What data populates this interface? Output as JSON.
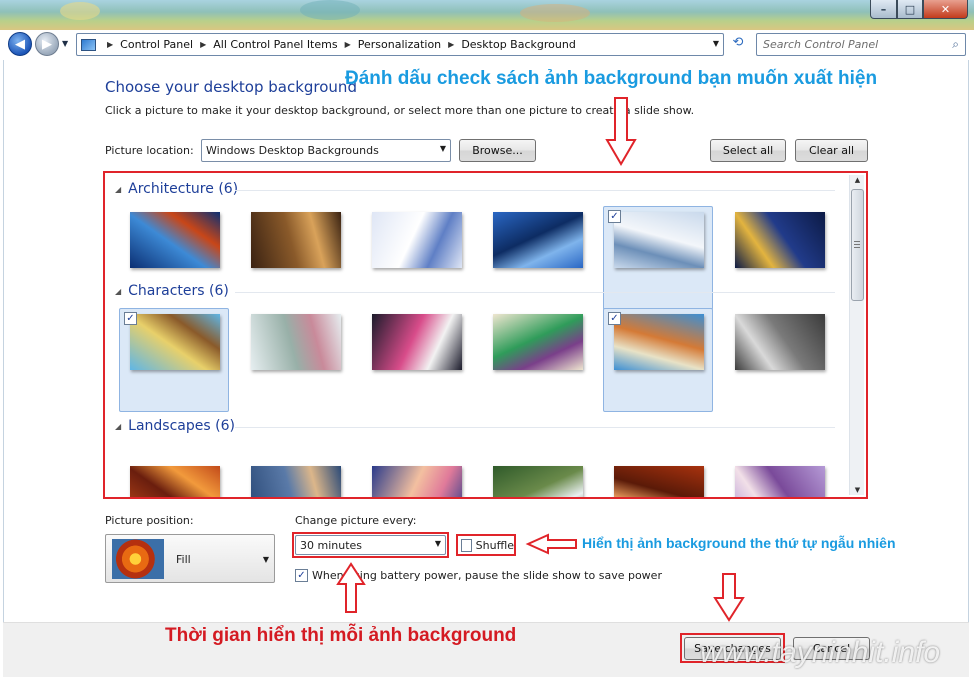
{
  "address": {
    "crumbs": [
      "Control Panel",
      "All Control Panel Items",
      "Personalization",
      "Desktop Background"
    ],
    "search_placeholder": "Search Control Panel"
  },
  "window_buttons": {
    "minimize": "–",
    "maximize": "□",
    "close": "✕"
  },
  "heading": "Choose your desktop background",
  "subtext": "Click a picture to make it your desktop background, or select more than one picture to create a slide show.",
  "picture_location": {
    "label": "Picture location:",
    "value": "Windows Desktop Backgrounds",
    "browse": "Browse...",
    "select_all": "Select all",
    "clear_all": "Clear all"
  },
  "groups": [
    {
      "title": "Architecture (6)",
      "items": [
        {
          "selected": false,
          "colors": [
            "#0b2f73",
            "#c84618",
            "#3d8ad6"
          ]
        },
        {
          "selected": false,
          "colors": [
            "#3a2212",
            "#d9a25a",
            "#8a5a2a"
          ]
        },
        {
          "selected": false,
          "colors": [
            "#dfe6f5",
            "#5f7fc5",
            "#ffffff"
          ]
        },
        {
          "selected": false,
          "colors": [
            "#2a67c4",
            "#7fb4ec",
            "#0d2c63"
          ]
        },
        {
          "selected": true,
          "colors": [
            "#c9d9ec",
            "#6c8fb8",
            "#f3f6fa"
          ]
        },
        {
          "selected": false,
          "colors": [
            "#0c1a45",
            "#e3b43f",
            "#213b8a"
          ]
        }
      ]
    },
    {
      "title": "Characters (6)",
      "items": [
        {
          "selected": true,
          "colors": [
            "#5fb6e6",
            "#8a5a2a",
            "#e8d06a"
          ]
        },
        {
          "selected": false,
          "colors": [
            "#e6eef0",
            "#c98a9a",
            "#98b0a8"
          ]
        },
        {
          "selected": false,
          "colors": [
            "#1b1b2b",
            "#f2f2f2",
            "#d84c8a"
          ]
        },
        {
          "selected": false,
          "colors": [
            "#efe6d0",
            "#7a3f8a",
            "#2f9c5a"
          ]
        },
        {
          "selected": true,
          "colors": [
            "#3d8fd3",
            "#e8e2c6",
            "#d47a36"
          ]
        },
        {
          "selected": false,
          "colors": [
            "#3b3b3b",
            "#d9d9d9",
            "#7a7a7a"
          ]
        }
      ]
    },
    {
      "title": "Landscapes (6)",
      "items": [
        {
          "selected": false,
          "colors": [
            "#c24a1a",
            "#f29a3c",
            "#6a1e0e"
          ]
        },
        {
          "selected": false,
          "colors": [
            "#2b4a78",
            "#dcb68a",
            "#5a7aa8"
          ]
        },
        {
          "selected": false,
          "colors": [
            "#2a3a8a",
            "#e07a9a",
            "#f3c0a0"
          ]
        },
        {
          "selected": false,
          "colors": [
            "#2f5a2a",
            "#e9f0f0",
            "#6a8a4a"
          ]
        },
        {
          "selected": false,
          "colors": [
            "#a8320e",
            "#f0a060",
            "#5a1a08"
          ]
        },
        {
          "selected": false,
          "colors": [
            "#b59ad6",
            "#f2e0e8",
            "#7a4a9a"
          ]
        }
      ]
    }
  ],
  "picture_position": {
    "label": "Picture position:",
    "value": "Fill"
  },
  "change_picture": {
    "label": "Change picture every:",
    "value": "30 minutes"
  },
  "shuffle": {
    "label": "Shuffle",
    "checked": false
  },
  "battery": {
    "label": "When using battery power, pause the slide show to save power",
    "checked": true
  },
  "buttons": {
    "save": "Save changes",
    "cancel": "Cancel"
  },
  "annotations": {
    "check": "Đánh dấu check sách ảnh background bạn muốn xuất hiện",
    "shuffle": "Hiển thị ảnh background the thứ tự ngẫu nhiên",
    "time": "Thời gian hiển thị mỗi ảnh background"
  },
  "watermark": "www.tayninhit.info",
  "check_glyph": "✓"
}
